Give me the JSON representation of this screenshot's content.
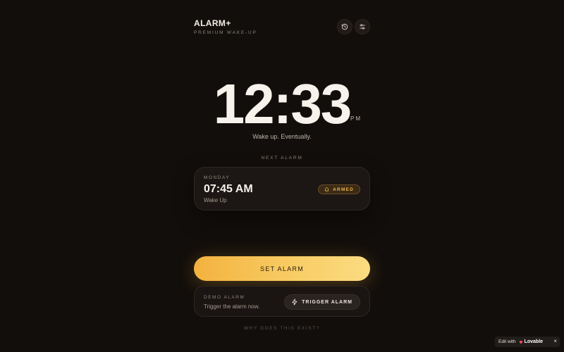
{
  "header": {
    "title": "ALARM+",
    "subtitle": "PREMIUM WAKE-UP",
    "history_icon": "history-icon",
    "settings_icon": "sliders-icon"
  },
  "clock": {
    "time": "12:33",
    "period": "PM",
    "tagline": "Wake up. Eventually."
  },
  "next_alarm": {
    "section_label": "NEXT ALARM",
    "day": "MONDAY",
    "time": "07:45 AM",
    "name": "Wake Up",
    "status": "ARMED",
    "status_icon": "bell-icon"
  },
  "actions": {
    "set_alarm_label": "SET ALARM"
  },
  "demo": {
    "label": "DEMO ALARM",
    "description": "Trigger the alarm now.",
    "trigger_label": "TRIGGER ALARM",
    "trigger_icon": "lightning-icon"
  },
  "footer": {
    "why_link": "WHY DOES THIS EXIST?"
  },
  "badge": {
    "prefix": "Edit with",
    "brand": "Lovable",
    "close": "×"
  },
  "colors": {
    "background": "#120e0b",
    "accent": "#f5b83f",
    "armed": "#f0b34c"
  }
}
